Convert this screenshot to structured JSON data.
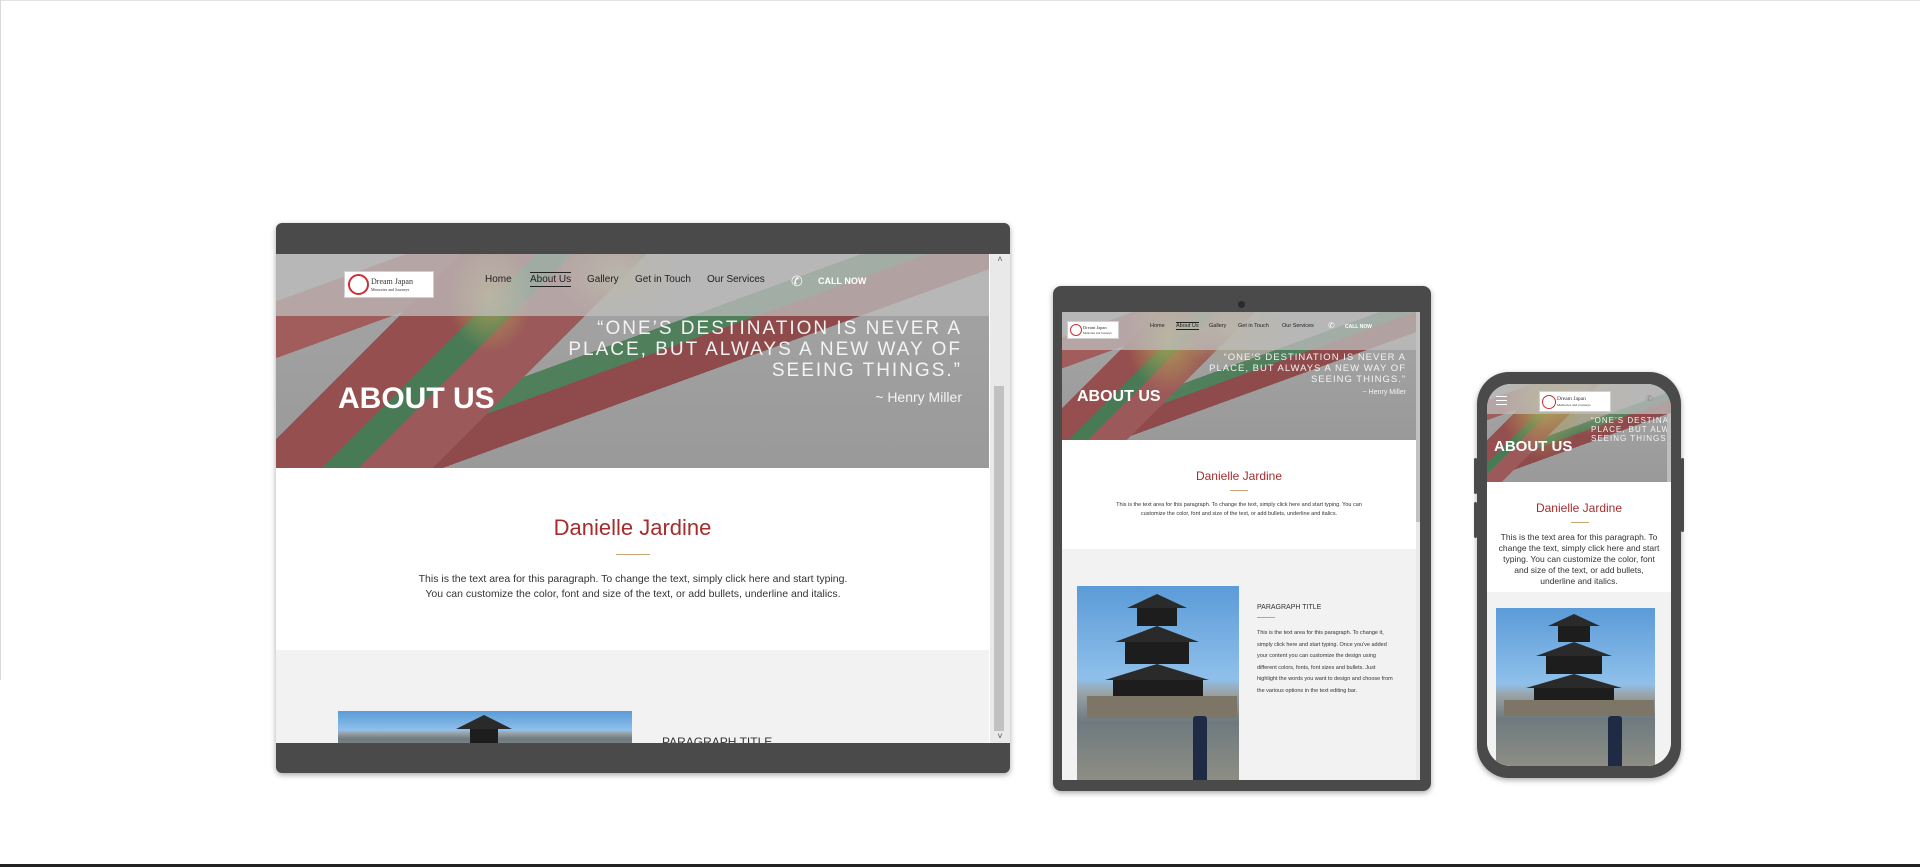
{
  "site": {
    "logo": {
      "name": "Dream Japan",
      "tagline": "Memories and Journeys"
    },
    "nav": [
      "Home",
      "About Us",
      "Gallery",
      "Get in Touch",
      "Our Services"
    ],
    "active_nav": "About Us",
    "call_now": "CALL NOW",
    "hero": {
      "quote": "“ONE’S DESTINATION IS NEVER A PLACE, BUT ALWAYS A NEW WAY OF SEEING THINGS.”",
      "quote_author": "~ Henry Miller",
      "title": "ABOUT US"
    },
    "profile": {
      "name": "Danielle Jardine",
      "paragraph": "This is the text area for this paragraph. To change the text, simply click here and start typing. You can customize the color, font and size of the text, or add bullets, underline and italics."
    },
    "feature": {
      "title": "PARAGRAPH TITLE",
      "paragraph": "This is the text area for this paragraph. To change it, simply click here and start typing. Once you've added your content you can customize the design using different colors, fonts, font sizes and bullets. Just highlight the words you want to design and choose from the various options in the text editing bar."
    }
  },
  "icons": {
    "phone": "phone-icon",
    "menu": "hamburger-menu-icon",
    "scroll_up": "chevron-up-icon",
    "scroll_down": "chevron-down-icon"
  },
  "glyphs": {
    "phone": "✆",
    "up": "˄",
    "down": "˅"
  },
  "colors": {
    "device_frame": "#4a4a4a",
    "accent_red": "#a52d2d",
    "divider_gold": "#c8a472",
    "band_gray": "#f2f2f2"
  }
}
